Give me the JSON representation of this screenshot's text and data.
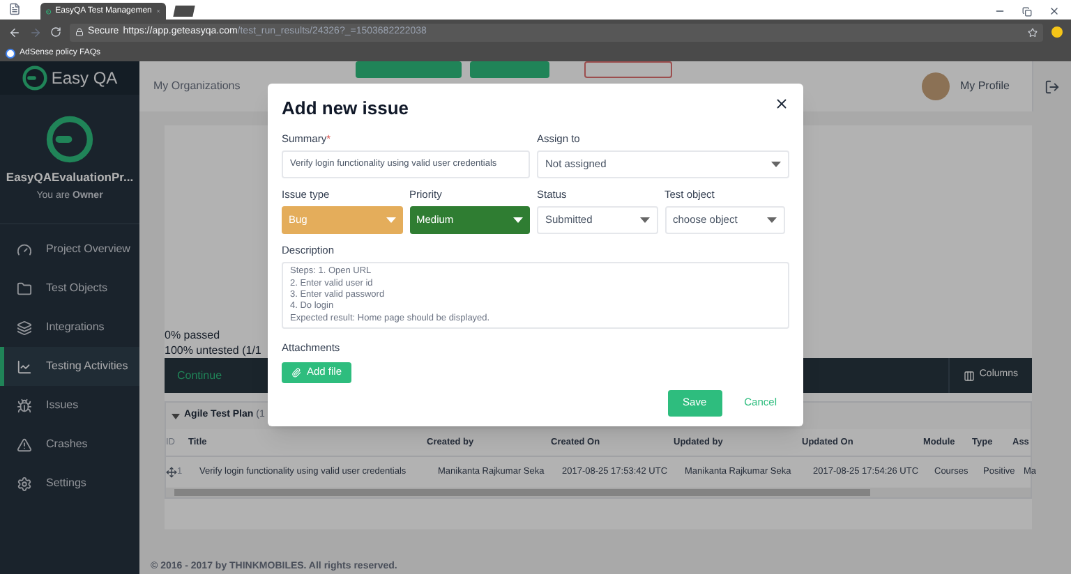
{
  "browser": {
    "tab_title": "EasyQA Test Managemen",
    "secure": "Secure",
    "url_host": "https://app.geteasyqa.com",
    "url_path": "/test_run_results/24326?_=1503682222038",
    "bookmark": "AdSense policy FAQs"
  },
  "sidebar": {
    "logo_text": "Easy QA",
    "project_name": "EasyQAEvaluationPr...",
    "role": "You are **Owner**",
    "items": [
      {
        "label": "Project Overview",
        "selected": false
      },
      {
        "label": "Test Objects",
        "selected": false
      },
      {
        "label": "Integrations",
        "selected": false
      },
      {
        "label": "Testing Activities",
        "selected": true
      },
      {
        "label": "Issues",
        "selected": false
      },
      {
        "label": "Crashes",
        "selected": false
      },
      {
        "label": "Settings",
        "selected": false
      }
    ]
  },
  "topbar": {
    "nav": "My Organizations",
    "profile": "My Profile"
  },
  "progress": [
    "0% passed",
    "100% untested (1/1"
  ],
  "toolbar": {
    "continue": "Continue",
    "columns": "Columns"
  },
  "plan": {
    "title": "Agile Test Plan",
    "count": "(1",
    "expanded": true
  },
  "table": {
    "columns": [
      "ID",
      "Title",
      "Created by",
      "Created On",
      "Updated by",
      "Updated On",
      "Module",
      "Type",
      "Ass"
    ],
    "rows": [
      [
        "1",
        "Verify login functionality using valid user credentials",
        "Manikanta Rajkumar Seka",
        "2017-08-25 17:53:42 UTC",
        "Manikanta Rajkumar Seka",
        "2017-08-25 17:54:26 UTC",
        "Courses",
        "Positive",
        "Ma"
      ]
    ]
  },
  "footer": "© 2016 - 2017 by THINKMOBILES. All rights reserved.",
  "modal": {
    "title": "Add new issue",
    "summary": {
      "label": "Summary",
      "required_mark": "*",
      "value": "Verify login functionality using valid user credentials"
    },
    "assign": {
      "label": "Assign to",
      "value": "Not assigned"
    },
    "selects": [
      {
        "label": "Issue type",
        "value": "Bug",
        "color": "#e4ad5b"
      },
      {
        "label": "Priority",
        "value": "Medium",
        "color": "#2f7d32"
      },
      {
        "label": "Status",
        "value": "Submitted"
      },
      {
        "label": "Test object",
        "value": "choose object"
      }
    ],
    "description": {
      "label": "Description",
      "lines": [
        "Steps: 1. Open URL",
        "2. Enter valid user id",
        "3. Enter valid password",
        "4. Do login",
        "Expected result: Home page should be displayed."
      ]
    },
    "attachments": {
      "label": "Attachments",
      "button": "Add file"
    },
    "save": "Save",
    "cancel": "Cancel"
  }
}
